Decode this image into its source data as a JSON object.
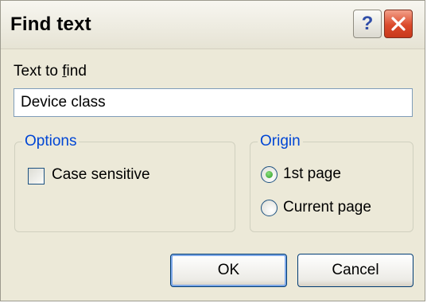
{
  "dialog": {
    "title": "Find text",
    "help_glyph": "?",
    "help_icon": "help-question-icon",
    "close_icon": "close-x-icon"
  },
  "find": {
    "label_prefix": "Text to ",
    "label_accel": "f",
    "label_suffix": "ind",
    "value": "Device class"
  },
  "options": {
    "group_label": "Options",
    "case_sensitive": {
      "label": "Case sensitive",
      "checked": false
    }
  },
  "origin": {
    "group_label": "Origin",
    "choices": [
      {
        "label": "1st page",
        "selected": true
      },
      {
        "label": "Current page",
        "selected": false
      }
    ]
  },
  "buttons": {
    "ok": "OK",
    "cancel": "Cancel"
  },
  "colors": {
    "group_label": "#0046d5",
    "close_button": "#db4a2b",
    "radio_selected": "#2e9b24",
    "dialog_bg": "#ece9d8"
  }
}
